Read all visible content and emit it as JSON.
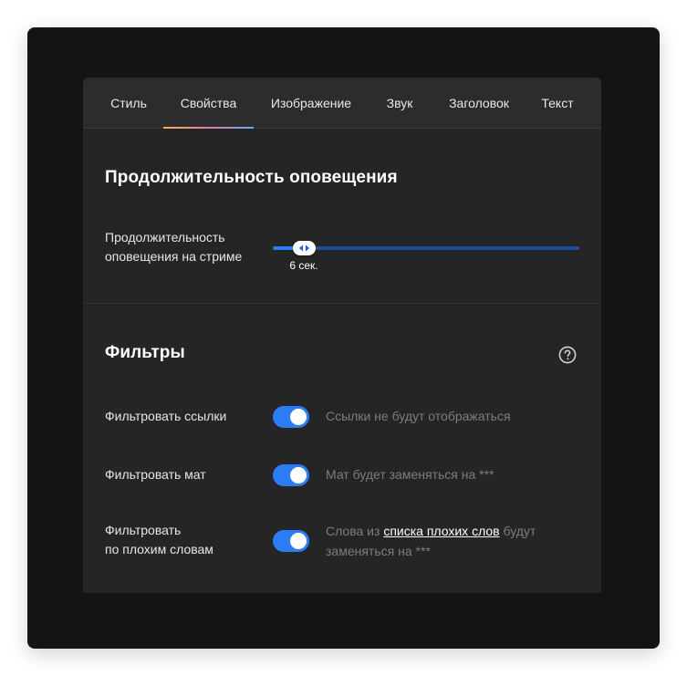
{
  "tabs": [
    {
      "label": "Стиль",
      "active": false
    },
    {
      "label": "Свойства",
      "active": true
    },
    {
      "label": "Изображение",
      "active": false
    },
    {
      "label": "Звук",
      "active": false
    },
    {
      "label": "Заголовок",
      "active": false
    },
    {
      "label": "Текст",
      "active": false
    }
  ],
  "duration": {
    "title": "Продолжительность оповещения",
    "label_line1": "Продолжительность",
    "label_line2": "оповещения на стриме",
    "slider": {
      "value_label": "6 сек.",
      "fraction": 0.1
    }
  },
  "filters": {
    "title": "Фильтры",
    "help_icon": "question-circle-icon",
    "items": [
      {
        "label": "Фильтровать ссылки",
        "enabled": true,
        "description": "Ссылки не будут отображаться"
      },
      {
        "label": "Фильтровать мат",
        "enabled": true,
        "description": "Мат будет заменяться на ***"
      },
      {
        "label_line1": "Фильтровать",
        "label_line2": "по плохим словам",
        "enabled": true,
        "desc_prefix": "Слова из ",
        "desc_link": "списка плохих слов",
        "desc_suffix": " будут",
        "desc_line2": "заменяться на ***"
      }
    ]
  },
  "colors": {
    "accent": "#2c7cf6",
    "panel": "#252526",
    "background": "#141416"
  }
}
